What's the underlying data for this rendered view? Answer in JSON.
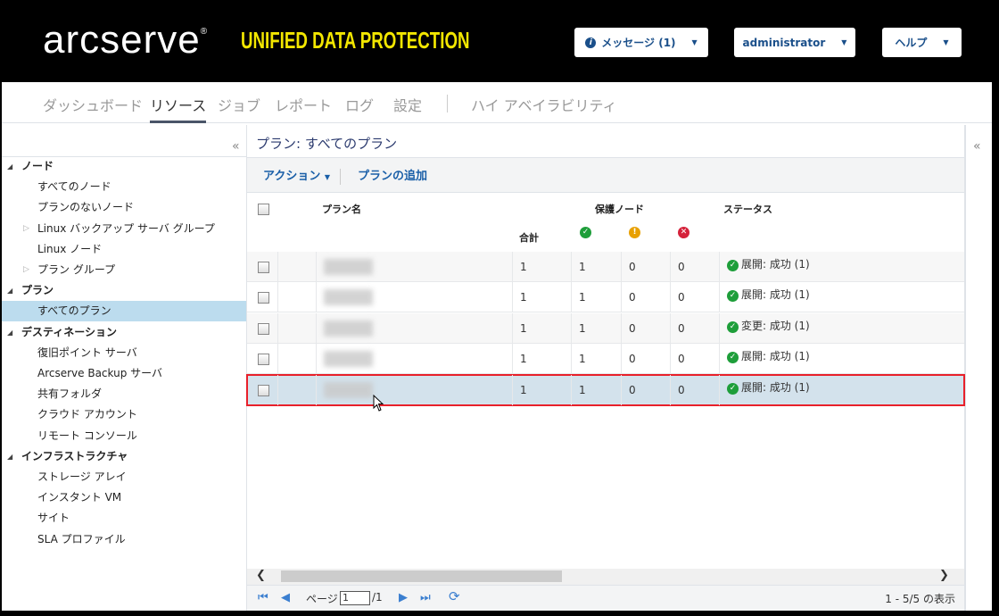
{
  "header": {
    "logo": "arcserve",
    "logo_mark": "®",
    "product": "UNIFIED DATA PROTECTION",
    "messages_label": "メッセージ (1)",
    "user_label": "administrator",
    "help_label": "ヘルプ"
  },
  "nav": {
    "items": [
      "ダッシュボード",
      "リソース",
      "ジョブ",
      "レポート",
      "ログ",
      "設定",
      "ハイ アベイラビリティ"
    ],
    "active": "リソース"
  },
  "sidebar": {
    "collapse_icon": "«",
    "items": [
      {
        "label": "ノード",
        "type": "group"
      },
      {
        "label": "すべてのノード",
        "type": "item"
      },
      {
        "label": "プランのないノード",
        "type": "item"
      },
      {
        "label": "Linux バックアップ サーバ グループ",
        "type": "expandable"
      },
      {
        "label": "Linux ノード",
        "type": "item"
      },
      {
        "label": "プラン グループ",
        "type": "expandable"
      },
      {
        "label": "プラン",
        "type": "group"
      },
      {
        "label": "すべてのプラン",
        "type": "item",
        "selected": true
      },
      {
        "label": "デスティネーション",
        "type": "group"
      },
      {
        "label": "復旧ポイント サーバ",
        "type": "item"
      },
      {
        "label": "Arcserve Backup サーバ",
        "type": "item"
      },
      {
        "label": "共有フォルダ",
        "type": "item"
      },
      {
        "label": "クラウド アカウント",
        "type": "item"
      },
      {
        "label": "リモート コンソール",
        "type": "item"
      },
      {
        "label": "インフラストラクチャ",
        "type": "group"
      },
      {
        "label": "ストレージ アレイ",
        "type": "item"
      },
      {
        "label": "インスタント VM",
        "type": "item"
      },
      {
        "label": "サイト",
        "type": "item"
      },
      {
        "label": "SLA プロファイル",
        "type": "item"
      }
    ]
  },
  "main": {
    "title": "プラン: すべてのプラン",
    "toolbar": {
      "actions": "アクション",
      "add_plan": "プランの追加"
    },
    "columns": {
      "plan_name": "プラン名",
      "protected_nodes": "保護ノード",
      "status": "ステータス",
      "total": "合計"
    },
    "rows": [
      {
        "total": "1",
        "ok": "1",
        "warn": "0",
        "err": "0",
        "status": "展開: 成功 (1)"
      },
      {
        "total": "1",
        "ok": "1",
        "warn": "0",
        "err": "0",
        "status": "展開: 成功 (1)"
      },
      {
        "total": "1",
        "ok": "1",
        "warn": "0",
        "err": "0",
        "status": "変更: 成功 (1)"
      },
      {
        "total": "1",
        "ok": "1",
        "warn": "0",
        "err": "0",
        "status": "展開: 成功 (1)"
      },
      {
        "total": "1",
        "ok": "1",
        "warn": "0",
        "err": "0",
        "status": "展開: 成功 (1)",
        "selected": true
      }
    ],
    "pager": {
      "page_label": "ページ",
      "page": "1",
      "of": "/1",
      "summary": "1 - 5/5 の表示"
    }
  },
  "colors": {
    "accent": "#1a5fa8",
    "selection": "#d3e2ec",
    "highlight_border": "#e8202a",
    "logo_yellow": "#f2e600"
  }
}
